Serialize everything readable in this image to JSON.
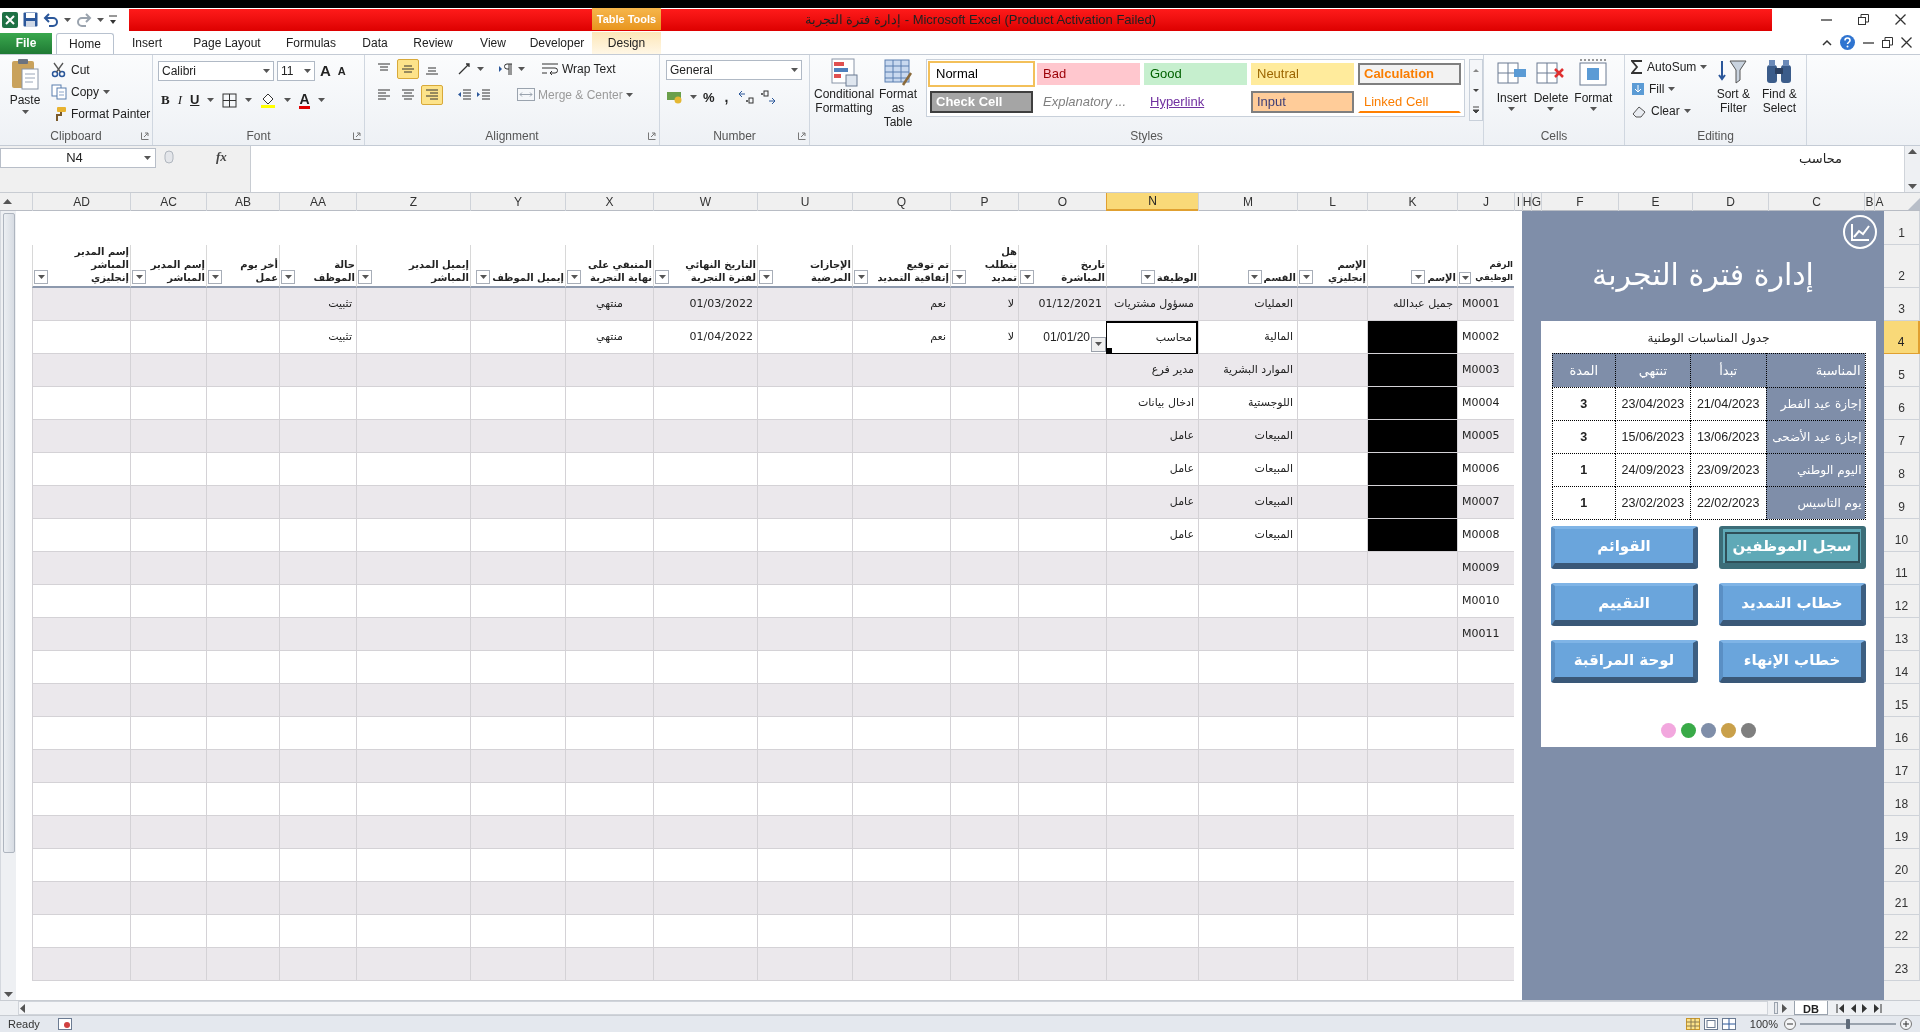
{
  "window": {
    "title": "إدارة فترة التجربة  -  Microsoft Excel (Product Activation Failed)",
    "context_group": "Table Tools"
  },
  "tabs": [
    {
      "label": "Design",
      "kind": "contextual",
      "selected": false
    },
    {
      "label": "Developer",
      "kind": "tab",
      "selected": false
    },
    {
      "label": "View",
      "kind": "tab",
      "selected": false
    },
    {
      "label": "Review",
      "kind": "tab",
      "selected": false
    },
    {
      "label": "Data",
      "kind": "tab",
      "selected": false
    },
    {
      "label": "Formulas",
      "kind": "tab",
      "selected": false
    },
    {
      "label": "Page Layout",
      "kind": "tab",
      "selected": false
    },
    {
      "label": "Insert",
      "kind": "tab",
      "selected": false
    },
    {
      "label": "Home",
      "kind": "tab",
      "selected": true
    },
    {
      "label": "File",
      "kind": "file",
      "selected": false
    }
  ],
  "ribbon": {
    "clipboard": {
      "label": "Clipboard",
      "paste": "Paste",
      "cut": "Cut",
      "copy": "Copy",
      "format_painter": "Format Painter"
    },
    "font": {
      "label": "Font",
      "family": "Calibri",
      "size": "11",
      "grow": "A",
      "shrink": "A",
      "bold": "B",
      "italic": "I",
      "underline": "U",
      "foreground": "A"
    },
    "alignment": {
      "label": "Alignment",
      "wrap_text": "Wrap Text",
      "merge_center": "Merge & Center",
      "vertical": [
        {
          "selected": false
        },
        {
          "selected": true
        },
        {
          "selected": false
        }
      ],
      "horizontal": [
        {
          "selected": false
        },
        {
          "selected": false
        },
        {
          "selected": true
        }
      ]
    },
    "number": {
      "label": "Number",
      "format": "General",
      "percent": "%",
      "comma": ","
    },
    "styles": {
      "label": "Styles",
      "conditional_formatting": "Conditional Formatting",
      "format_as_table": "Format as Table",
      "cell_styles": [
        {
          "label": "Calculation",
          "kind": "calculation",
          "selected": false
        },
        {
          "label": "Neutral",
          "kind": "neutral",
          "selected": false
        },
        {
          "label": "Good",
          "kind": "good",
          "selected": false
        },
        {
          "label": "Bad",
          "kind": "bad",
          "selected": false
        },
        {
          "label": "Normal",
          "kind": "normal",
          "selected": true
        },
        {
          "label": "Linked Cell",
          "kind": "linked",
          "selected": false
        },
        {
          "label": "Input",
          "kind": "input",
          "selected": false
        },
        {
          "label": "Hyperlink",
          "kind": "hyperlink",
          "selected": false
        },
        {
          "label": "Explanatory ...",
          "kind": "explanatory",
          "selected": false
        },
        {
          "label": "Check Cell",
          "kind": "check",
          "selected": false
        }
      ]
    },
    "cells": {
      "label": "Cells",
      "insert": "Insert",
      "delete": "Delete",
      "format": "Format"
    },
    "editing": {
      "label": "Editing",
      "autosum": "AutoSum",
      "fill": "Fill",
      "clear": "Clear",
      "sort_filter": "Sort & Filter",
      "find_select": "Find & Select"
    }
  },
  "formula_bar": {
    "name_box": "N4",
    "fx": "fx",
    "content": "محاسب"
  },
  "sheet": {
    "columns": [
      {
        "label": "A",
        "selected": false
      },
      {
        "label": "B",
        "selected": false
      },
      {
        "label": "C",
        "selected": false
      },
      {
        "label": "D",
        "selected": false
      },
      {
        "label": "E",
        "selected": false
      },
      {
        "label": "F",
        "selected": false
      },
      {
        "label": "G",
        "selected": false
      },
      {
        "label": "H",
        "selected": false
      },
      {
        "label": "I",
        "selected": false
      },
      {
        "label": "J",
        "selected": false
      },
      {
        "label": "K",
        "selected": false
      },
      {
        "label": "L",
        "selected": false
      },
      {
        "label": "M",
        "selected": false
      },
      {
        "label": "N",
        "selected": true
      },
      {
        "label": "O",
        "selected": false
      },
      {
        "label": "P",
        "selected": false
      },
      {
        "label": "Q",
        "selected": false
      },
      {
        "label": "U",
        "selected": false
      },
      {
        "label": "W",
        "selected": false
      },
      {
        "label": "X",
        "selected": false
      },
      {
        "label": "Y",
        "selected": false
      },
      {
        "label": "Z",
        "selected": false
      },
      {
        "label": "AA",
        "selected": false
      },
      {
        "label": "AB",
        "selected": false
      },
      {
        "label": "AC",
        "selected": false
      },
      {
        "label": "AD",
        "selected": false
      }
    ],
    "row_numbers": [
      {
        "label": "1",
        "selected": false
      },
      {
        "label": "2",
        "selected": false
      },
      {
        "label": "3",
        "selected": false
      },
      {
        "label": "4",
        "selected": true
      },
      {
        "label": "5",
        "selected": false
      },
      {
        "label": "6",
        "selected": false
      },
      {
        "label": "7",
        "selected": false
      },
      {
        "label": "8",
        "selected": false
      },
      {
        "label": "9",
        "selected": false
      },
      {
        "label": "10",
        "selected": false
      },
      {
        "label": "11",
        "selected": false
      },
      {
        "label": "12",
        "selected": false
      },
      {
        "label": "13",
        "selected": false
      },
      {
        "label": "14",
        "selected": false
      },
      {
        "label": "15",
        "selected": false
      },
      {
        "label": "16",
        "selected": false
      },
      {
        "label": "17",
        "selected": false
      },
      {
        "label": "18",
        "selected": false
      },
      {
        "label": "19",
        "selected": false
      },
      {
        "label": "20",
        "selected": false
      },
      {
        "label": "21",
        "selected": false
      },
      {
        "label": "22",
        "selected": false
      },
      {
        "label": "23",
        "selected": false
      }
    ],
    "table": {
      "headers": [
        "الرقم الوظيفي",
        "الإسم",
        "الإسم إنجليزي",
        "القسم",
        "الوظيفة",
        "تاريخ المباشرة",
        "هل يتطلب تمديد",
        "تم توقيع إتفاقية التمديد",
        "الإجازات المرضية",
        "التاريخ النهائي لفترة التجربة",
        "المتبقي على نهاية التجربة",
        "إيميل الموظف",
        "إيميل المدير المباشر",
        "حالة الموظف",
        "أخر يوم عمل",
        "إسم المدير المباشر",
        "إسم المدير المباشر إنجليزي"
      ],
      "rows": [
        {
          "id": "M0001",
          "name": "جميل عبدالله",
          "name_redacted": false,
          "department": "العمليات",
          "job": "مسؤول مشتريات",
          "start_date": "01/12/2021",
          "needs_extension": "لا",
          "extension_signed": "نعم",
          "final_date": "01/03/2022",
          "remaining": "منتهي",
          "status": "تثبيت",
          "selected": false
        },
        {
          "id": "M0002",
          "name_redacted": true,
          "department": "المالية",
          "job": "محاسب",
          "start_date": "01/01/20",
          "needs_extension": "لا",
          "extension_signed": "نعم",
          "final_date": "01/04/2022",
          "remaining": "منتهي",
          "status": "تثبيت",
          "selected": true
        },
        {
          "id": "M0003",
          "name_redacted": true,
          "department": "الموارد البشرية",
          "job": "مدير فرع",
          "selected": false
        },
        {
          "id": "M0004",
          "name_redacted": true,
          "department": "اللوجستية",
          "job": "ادخال بيانات",
          "selected": false
        },
        {
          "id": "M0005",
          "name_redacted": true,
          "department": "المبيعات",
          "job": "عامل",
          "selected": false
        },
        {
          "id": "M0006",
          "name_redacted": true,
          "department": "المبيعات",
          "job": "عامل",
          "selected": false
        },
        {
          "id": "M0007",
          "name_redacted": true,
          "department": "المبيعات",
          "job": "عامل",
          "selected": false
        },
        {
          "id": "M0008",
          "name_redacted": true,
          "department": "المبيعات",
          "job": "عامل",
          "selected": false
        },
        {
          "id": "M0009",
          "name_redacted": false,
          "selected": false
        },
        {
          "id": "M0010",
          "name_redacted": false,
          "selected": false
        },
        {
          "id": "M0011",
          "name_redacted": false,
          "selected": false
        }
      ]
    }
  },
  "dashboard": {
    "title": "إدارة فترة التجربة",
    "holidays": {
      "title": "جدول المناسبات الوطنية",
      "columns": [
        "المناسبة",
        "تبدأ",
        "تنتهي",
        "المدة"
      ],
      "rows": [
        {
          "occasion": "إجازة عيد الفطر",
          "start": "21/04/2023",
          "end": "23/04/2023",
          "days": "3"
        },
        {
          "occasion": "إجازة عيد الأضحى",
          "start": "13/06/2023",
          "end": "15/06/2023",
          "days": "3"
        },
        {
          "occasion": "اليوم الوطني",
          "start": "23/09/2023",
          "end": "24/09/2023",
          "days": "1"
        },
        {
          "occasion": "يوم التاسيس",
          "start": "22/02/2023",
          "end": "23/02/2023",
          "days": "1"
        }
      ]
    },
    "buttons": [
      {
        "label": "سجل الموظفين",
        "selected": true
      },
      {
        "label": "القوائم",
        "selected": false
      },
      {
        "label": "خطاب التمديد",
        "selected": false
      },
      {
        "label": "التقييم",
        "selected": false
      },
      {
        "label": "خطاب الإنهاء",
        "selected": false
      },
      {
        "label": "لوحة المراقبة",
        "selected": false
      }
    ],
    "swatches": [
      {
        "color": "#f2a7de"
      },
      {
        "color": "#39aa48"
      },
      {
        "color": "#7f8ea9"
      },
      {
        "color": "#c9a04a"
      },
      {
        "color": "#7f7f7f"
      }
    ]
  },
  "sheet_tabs": [
    {
      "label": "DB",
      "selected": true
    }
  ],
  "status_bar": {
    "mode": "Ready",
    "zoom": "100%",
    "zoom_slider": {
      "level": 0.5
    }
  }
}
